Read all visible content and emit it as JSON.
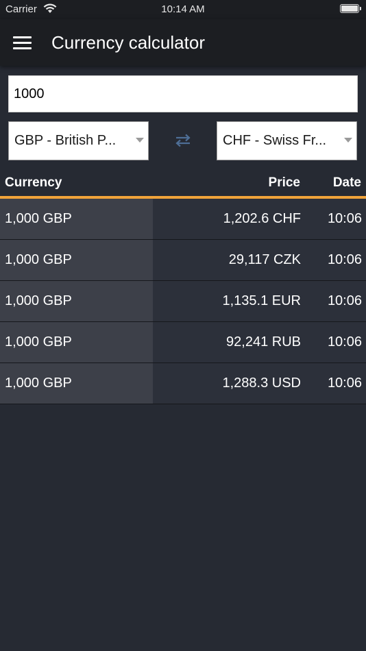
{
  "status_bar": {
    "carrier": "Carrier",
    "time": "10:14 AM"
  },
  "header": {
    "menu_icon": "hamburger-menu-icon",
    "title": "Currency calculator"
  },
  "converter": {
    "amount": "1000",
    "from_currency": "GBP - British P...",
    "to_currency": "CHF - Swiss Fr...",
    "swap_icon": "swap-arrows-icon"
  },
  "table": {
    "columns": [
      "Currency",
      "Price",
      "Date"
    ],
    "rows": [
      {
        "amount": "1,000 GBP",
        "price": "1,202.6 CHF",
        "date": "10:06"
      },
      {
        "amount": "1,000 GBP",
        "price": "29,117 CZK",
        "date": "10:06"
      },
      {
        "amount": "1,000 GBP",
        "price": "1,135.1 EUR",
        "date": "10:06"
      },
      {
        "amount": "1,000 GBP",
        "price": "92,241 RUB",
        "date": "10:06"
      },
      {
        "amount": "1,000 GBP",
        "price": "1,288.3 USD",
        "date": "10:06"
      }
    ]
  },
  "colors": {
    "background": "#262a33",
    "navbar": "#1c1e22",
    "accent": "#f0a33a",
    "row_left": "#3d4049",
    "row_right": "#2c303a"
  }
}
